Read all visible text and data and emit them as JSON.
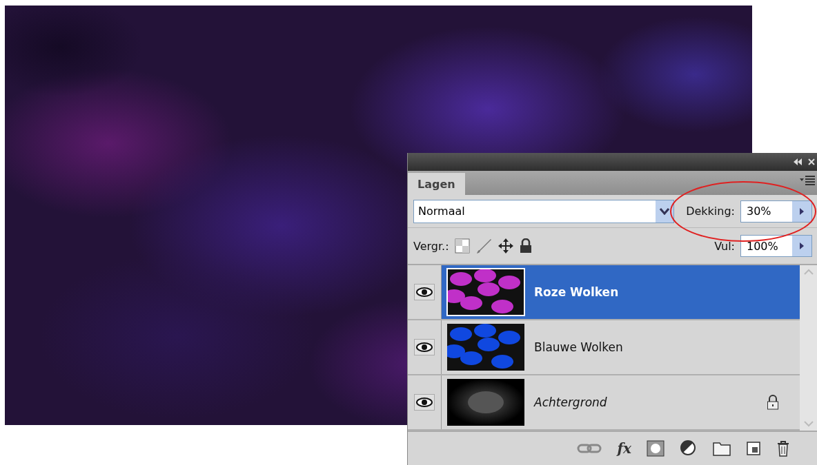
{
  "panel": {
    "tab": "Lagen",
    "blend_mode": "Normaal",
    "opacity_label": "Dekking:",
    "opacity": "30%",
    "lock_label": "Vergr.:",
    "fill_label": "Vul:",
    "fill": "100%",
    "opacity_highlighted": true
  },
  "layers": [
    {
      "name": "Roze Wolken",
      "selected": true,
      "visible": true,
      "kind": "layer",
      "locked": false,
      "color": "#c030c8"
    },
    {
      "name": "Blauwe Wolken",
      "selected": false,
      "visible": true,
      "kind": "layer",
      "locked": false,
      "color": "#1048e0"
    },
    {
      "name": "Achtergrond",
      "selected": false,
      "visible": true,
      "kind": "background",
      "locked": true,
      "color": "#555555"
    }
  ],
  "footer": {
    "fx": "fx"
  }
}
